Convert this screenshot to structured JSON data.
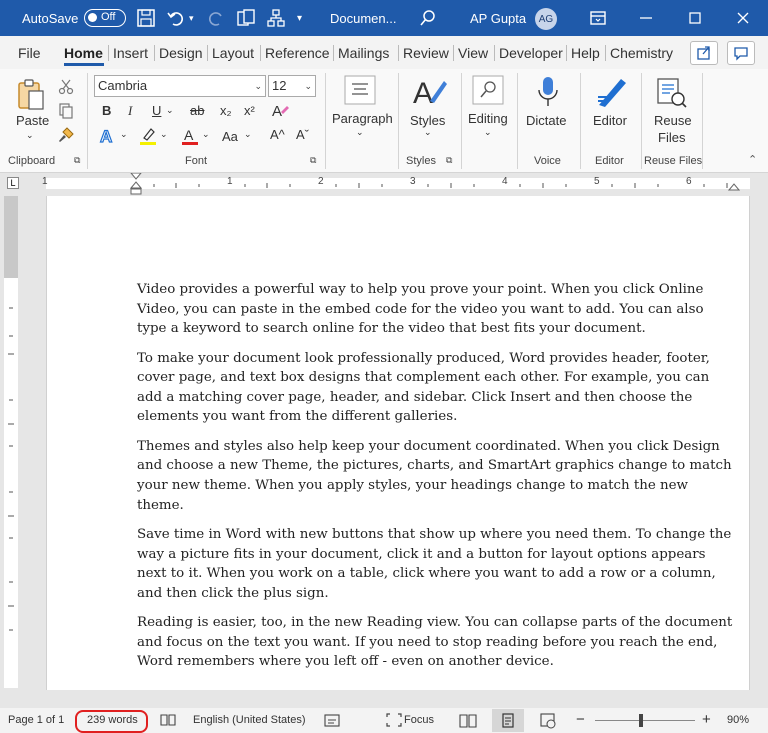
{
  "titlebar": {
    "autosave_label": "AutoSave",
    "autosave_state": "Off",
    "doc_title": "Documen...",
    "user_name": "AP Gupta",
    "user_initials": "AG"
  },
  "tabs": [
    "File",
    "Home",
    "Insert",
    "Design",
    "Layout",
    "Reference",
    "Mailings",
    "Review",
    "View",
    "Developer",
    "Help",
    "Chemistry"
  ],
  "active_tab": "Home",
  "ribbon": {
    "clipboard": {
      "paste_label": "Paste",
      "group_label": "Clipboard"
    },
    "font": {
      "font_name": "Cambria",
      "font_size": "12",
      "bold": "B",
      "italic": "I",
      "underline": "U",
      "strike": "ab",
      "subscript": "x₂",
      "superscript": "x²",
      "font_color_a": "A",
      "aa": "Aa",
      "grow": "A^",
      "shrink": "Aˇ",
      "group_label": "Font"
    },
    "paragraph": {
      "label": "Paragraph"
    },
    "styles": {
      "label": "Styles",
      "group_label": "Styles"
    },
    "editing": {
      "label": "Editing"
    },
    "voice": {
      "dictate_label": "Dictate",
      "group_label": "Voice"
    },
    "editor": {
      "label": "Editor",
      "group_label": "Editor"
    },
    "reuse": {
      "label_line1": "Reuse",
      "label_line2": "Files",
      "group_label": "Reuse Files"
    }
  },
  "ruler": {
    "marks": [
      "1",
      "1",
      "2",
      "3",
      "4",
      "5",
      "6"
    ]
  },
  "document": {
    "paragraphs": [
      "Video provides a powerful way to help you prove your point. When you click Online Video, you can paste in the embed code for the video you want to add. You can also type a keyword to search online for the video that best fits your document.",
      "To make your document look professionally produced, Word provides header, footer, cover page, and text box designs that complement each other. For example, you can add a matching cover page, header, and sidebar. Click Insert and then choose the elements you want from the different galleries.",
      "Themes and styles also help keep your document coordinated. When you click Design and choose a new Theme, the pictures, charts, and SmartArt graphics change to match your new theme. When you apply styles, your headings change to match the new theme.",
      "Save time in Word with new buttons that show up where you need them. To change the way a picture fits in your document, click it and a button for layout options appears next to it. When you work on a table, click where you want to add a row or a column, and then click the plus sign.",
      "Reading is easier, too, in the new Reading view. You can collapse parts of the document and focus on the text you want. If you need to stop reading before you reach the end, Word remembers where you left off - even on another device."
    ]
  },
  "status": {
    "page": "Page 1 of 1",
    "words": "239 words",
    "language": "English (United States)",
    "focus": "Focus",
    "zoom_minus": "−",
    "zoom_plus": "+",
    "zoom": "90%"
  },
  "colors": {
    "titlebar": "#1f5aaa",
    "highlight_box": "#e02020"
  }
}
